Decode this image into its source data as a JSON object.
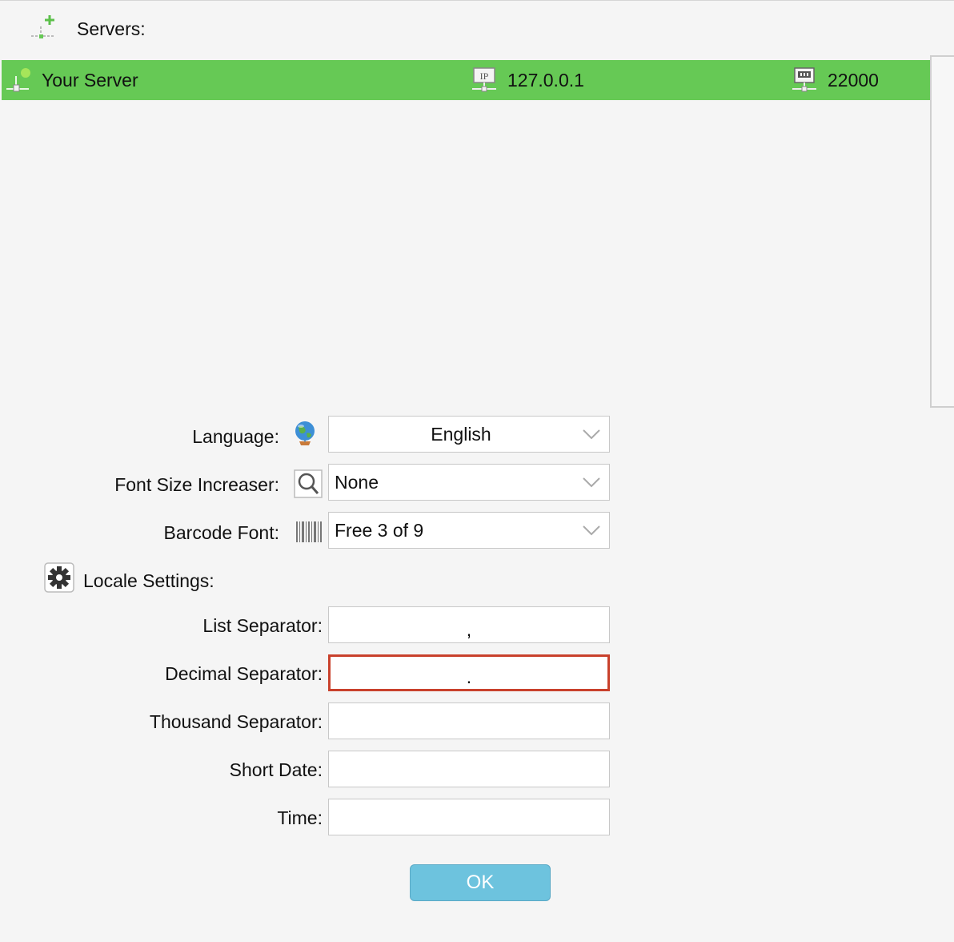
{
  "servers": {
    "header_label": "Servers:",
    "rows": [
      {
        "name": "Your Server",
        "ip": "127.0.0.1",
        "port": "22000"
      }
    ],
    "selected_color": "#66c955"
  },
  "settings": {
    "language": {
      "label": "Language:",
      "value": "English"
    },
    "font_size": {
      "label": "Font Size Increaser:",
      "value": "None"
    },
    "barcode_font": {
      "label": "Barcode Font:",
      "value": "Free 3 of 9"
    }
  },
  "locale": {
    "heading": "Locale Settings:",
    "list_separator": {
      "label": "List Separator:",
      "value": ","
    },
    "decimal_separator": {
      "label": "Decimal Separator:",
      "value": "."
    },
    "thousand_separator": {
      "label": "Thousand Separator:",
      "value": ""
    },
    "short_date": {
      "label": "Short Date:",
      "value": ""
    },
    "time": {
      "label": "Time:",
      "value": ""
    }
  },
  "ok_label": "OK"
}
